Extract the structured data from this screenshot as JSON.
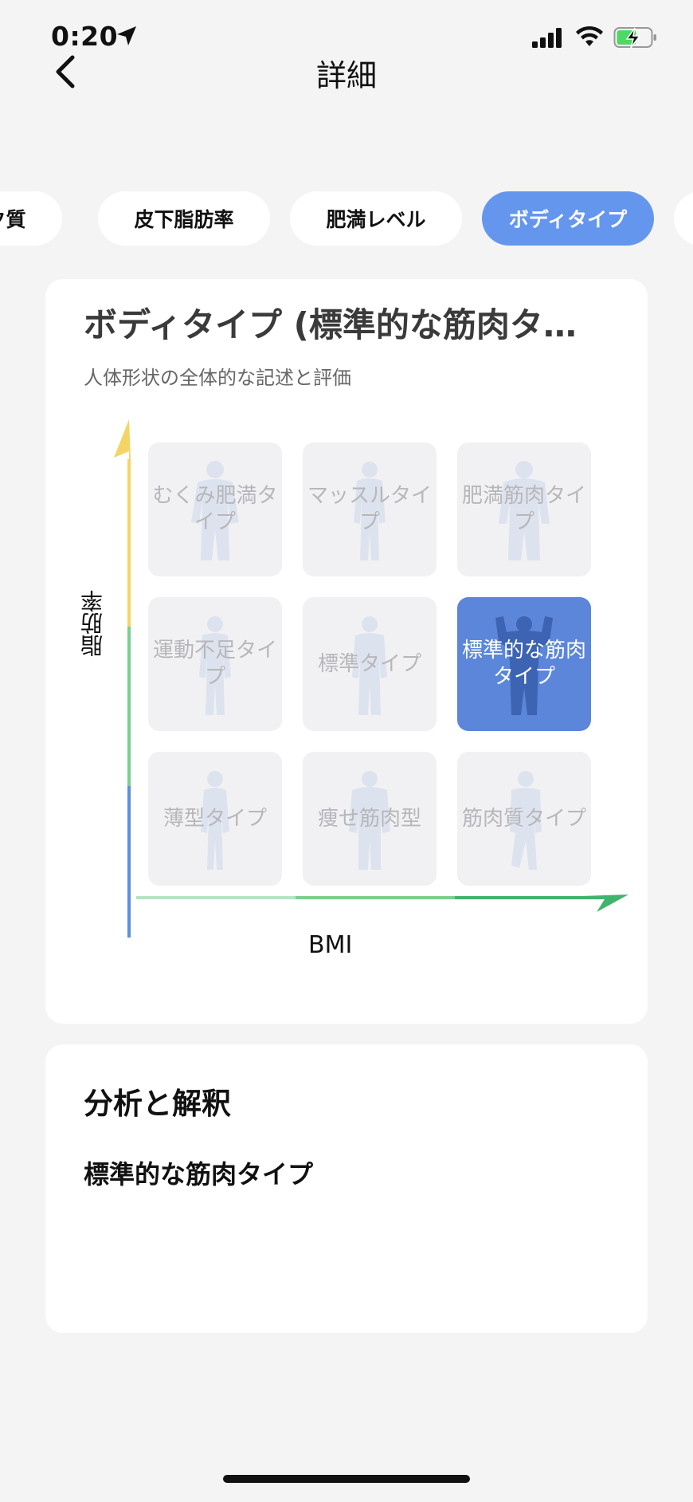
{
  "status": {
    "time": "0:20"
  },
  "nav": {
    "title": "詳細"
  },
  "tabs": [
    {
      "label": "タンパク質"
    },
    {
      "label": "皮下脂肪率"
    },
    {
      "label": "肥満レベル"
    },
    {
      "label": "ボディタイプ"
    },
    {
      "label": ""
    }
  ],
  "body_type_card": {
    "title": "ボディタイプ (標準的な筋肉タイプ)",
    "subtitle": "人体形状の全体的な記述と評価",
    "y_axis_label": "脂肪率",
    "x_axis_label": "BMI",
    "selected": "標準的な筋肉タイプ",
    "grid": [
      {
        "label": "むくみ肥満タイプ"
      },
      {
        "label": "マッスルタイプ"
      },
      {
        "label": "肥満筋肉タイプ"
      },
      {
        "label": "運動不足タイプ"
      },
      {
        "label": "標準タイプ"
      },
      {
        "label": "標準的な筋肉タイプ"
      },
      {
        "label": "薄型タイプ"
      },
      {
        "label": "痩せ筋肉型"
      },
      {
        "label": "筋肉質タイプ"
      }
    ]
  },
  "analysis_card": {
    "title": "分析と解釈",
    "result": "標準的な筋肉タイプ"
  },
  "colors": {
    "accent": "#6596ee",
    "selected_cell": "#5b86da",
    "axis_yellow": "#f4d564",
    "axis_green": "#7ccf8e",
    "axis_blue": "#5b8fe0",
    "axis_dark_green": "#3fb56b"
  }
}
